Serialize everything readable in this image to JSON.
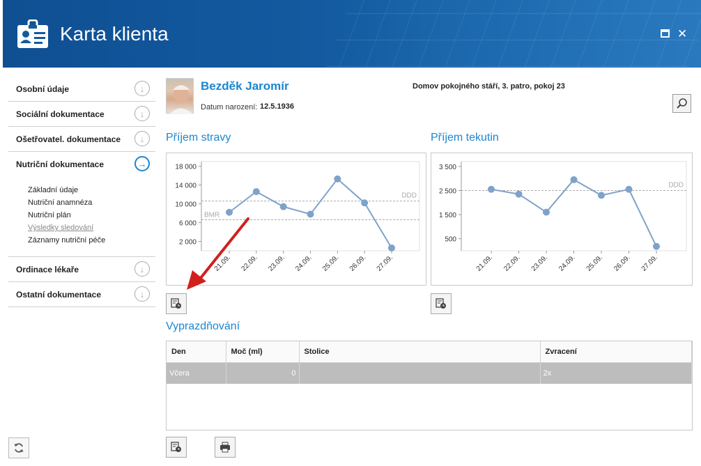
{
  "window": {
    "title": "Karta klienta"
  },
  "sidebar": {
    "items": [
      {
        "label": "Osobní údaje"
      },
      {
        "label": "Sociální dokumentace"
      },
      {
        "label": "Ošetřovatel. dokumentace"
      },
      {
        "label": "Nutriční dokumentace",
        "active": true
      },
      {
        "label": "Ordinace lékaře"
      },
      {
        "label": "Ostatní dokumentace"
      }
    ],
    "subitems": [
      "Základní údaje",
      "Nutriční anamnéza",
      "Nutriční plán",
      "Výsledky sledování",
      "Záznamy nutriční péče"
    ],
    "visited_subitem": "Výsledky sledování"
  },
  "client": {
    "name": "Bezděk Jaromír",
    "dob_label": "Datum narození:",
    "dob": "12.5.1936",
    "location": "Domov pokojného stáří, 3. patro, pokoj 23"
  },
  "sections": {
    "food": "Příjem stravy",
    "fluids": "Příjem tekutin",
    "excretion": "Vyprazdňování"
  },
  "table": {
    "headers": [
      "Den",
      "Moč (ml)",
      "Stolice",
      "Zvracení"
    ],
    "rows": [
      [
        "Včera",
        "0",
        "",
        "2x"
      ]
    ]
  },
  "colors": {
    "accent": "#1b86d0",
    "titlebar": "#135aa0",
    "series": "#7fa2c9",
    "highlight_arrow": "#d0201c"
  },
  "chart_data": [
    {
      "type": "line",
      "x": [
        "21.09.",
        "22.09.",
        "23.09.",
        "24.09.",
        "25.09.",
        "26.09.",
        "27.09."
      ],
      "values": [
        8200,
        12600,
        9400,
        7800,
        15300,
        10200,
        600
      ],
      "yticks": [
        "18 000",
        "14 000",
        "10 000",
        "6 000",
        "2 000"
      ],
      "ytick_values": [
        18000,
        14000,
        10000,
        6000,
        2000
      ],
      "ylim": [
        0,
        19000
      ],
      "reference_lines": [
        {
          "label": "DDD",
          "value": 10600
        },
        {
          "label": "BMR",
          "value": 6600
        }
      ]
    },
    {
      "type": "line",
      "x": [
        "21.09.",
        "22.09.",
        "23.09.",
        "24.09.",
        "25.09.",
        "26.09.",
        "27.09."
      ],
      "values": [
        2550,
        2350,
        1600,
        2950,
        2300,
        2550,
        180
      ],
      "yticks": [
        "3 500",
        "2 500",
        "1 500",
        "500"
      ],
      "ytick_values": [
        3500,
        2500,
        1500,
        500
      ],
      "ylim": [
        0,
        3700
      ],
      "reference_lines": [
        {
          "label": "DDD",
          "value": 2500
        }
      ]
    }
  ]
}
